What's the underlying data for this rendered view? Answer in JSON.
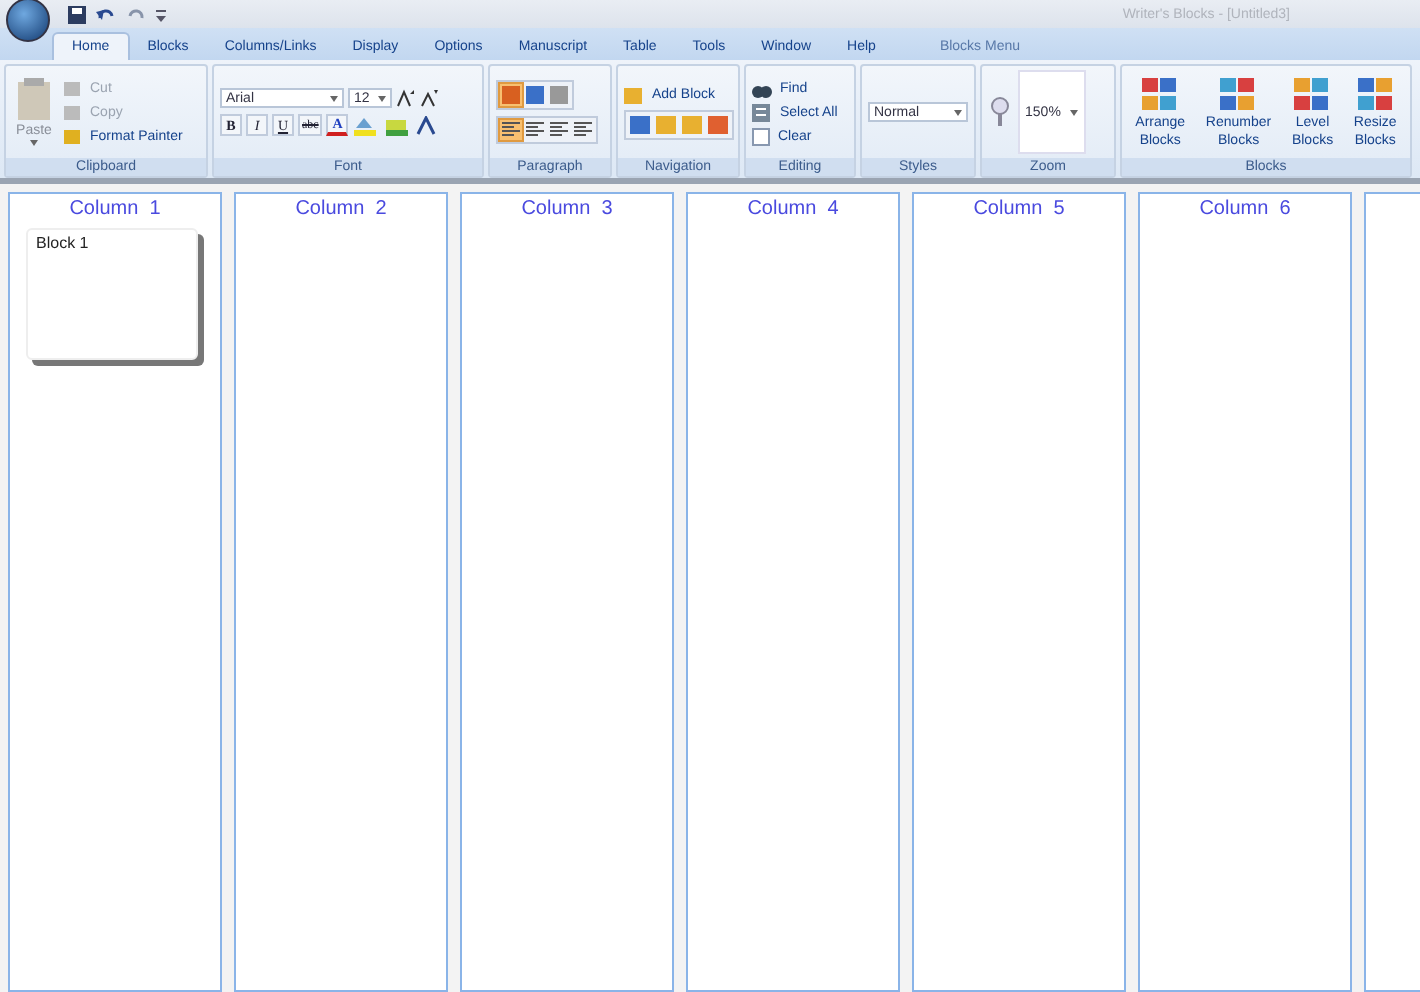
{
  "window": {
    "title": "Writer's Blocks - [Untitled3]"
  },
  "tabs": [
    {
      "label": "Home",
      "selected": true
    },
    {
      "label": "Blocks",
      "selected": false
    },
    {
      "label": "Columns/Links",
      "selected": false
    },
    {
      "label": "Display",
      "selected": false
    },
    {
      "label": "Options",
      "selected": false
    },
    {
      "label": "Manuscript",
      "selected": false
    },
    {
      "label": "Table",
      "selected": false
    },
    {
      "label": "Tools",
      "selected": false
    },
    {
      "label": "Window",
      "selected": false
    },
    {
      "label": "Help",
      "selected": false
    }
  ],
  "contextual_tab": "Blocks Menu",
  "clipboard": {
    "label": "Clipboard",
    "paste": "Paste",
    "items": [
      {
        "label": "Cut",
        "disabled": true
      },
      {
        "label": "Copy",
        "disabled": true
      },
      {
        "label": "Format Painter",
        "disabled": false
      }
    ]
  },
  "font": {
    "label": "Font",
    "family": "Arial",
    "size": "12",
    "styles": [
      "B",
      "I",
      "U",
      "abc"
    ],
    "color_glyph": "A"
  },
  "paragraph": {
    "label": "Paragraph",
    "views": [
      {
        "selected": true
      },
      {
        "selected": false
      },
      {
        "selected": false
      }
    ],
    "alignments": [
      {
        "selected": true
      },
      {
        "selected": false
      },
      {
        "selected": false
      },
      {
        "selected": false
      }
    ]
  },
  "navigation": {
    "label": "Navigation",
    "add": "Add Block"
  },
  "editing": {
    "label": "Editing",
    "find": "Find",
    "select_all": "Select All",
    "clear": {
      "label": "Clear",
      "checked": false
    }
  },
  "styles": {
    "label": "Styles",
    "value": "Normal"
  },
  "zoom": {
    "label": "Zoom",
    "value": "150%"
  },
  "blocks": {
    "label": "Blocks",
    "buttons": [
      {
        "lines": [
          "Arrange",
          "Blocks"
        ]
      },
      {
        "lines": [
          "Renumber",
          "Blocks"
        ]
      },
      {
        "lines": [
          "Level",
          "Blocks"
        ]
      },
      {
        "lines": [
          "Resize",
          "Blocks"
        ]
      }
    ]
  },
  "columns": [
    {
      "header": "Column  1",
      "blocks": [
        {
          "title": "Block 1"
        }
      ]
    },
    {
      "header": "Column  2"
    },
    {
      "header": "Column  3"
    },
    {
      "header": "Column  4"
    },
    {
      "header": "Column  5"
    },
    {
      "header": "Column  6"
    },
    {}
  ]
}
